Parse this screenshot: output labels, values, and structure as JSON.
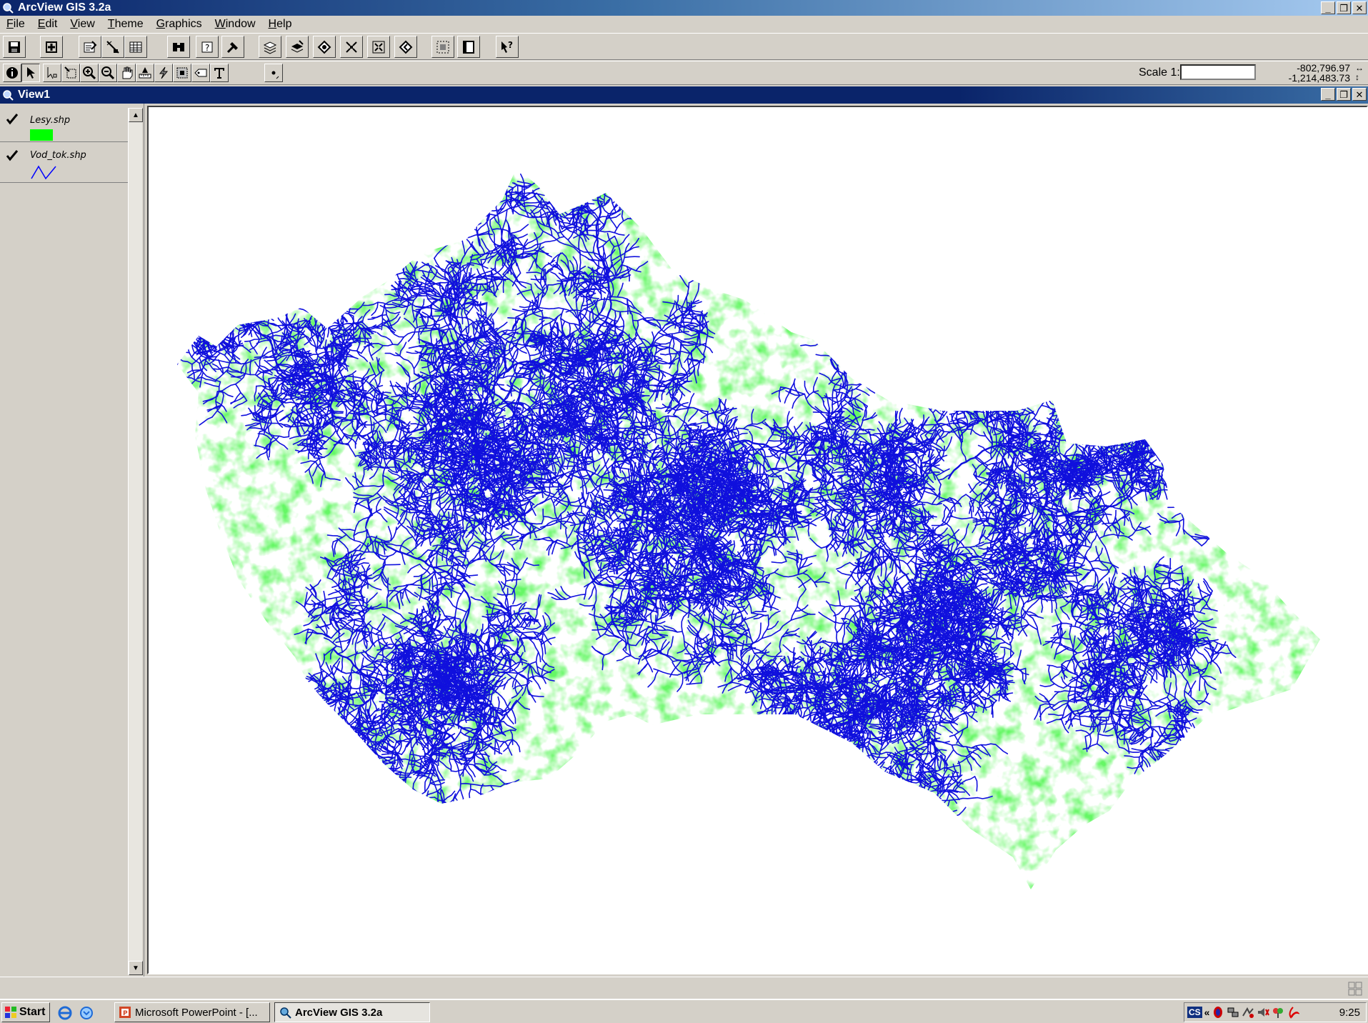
{
  "app": {
    "title": "ArcView GIS 3.2a"
  },
  "menu": [
    "File",
    "Edit",
    "View",
    "Theme",
    "Graphics",
    "Window",
    "Help"
  ],
  "toolbar": {
    "buttons": [
      "save-icon",
      "add-theme-icon",
      "theme-properties-icon",
      "edit-legend-icon",
      "open-table-icon",
      "find-icon",
      "locate-address-icon",
      "query-builder-icon",
      "zoom-to-full-extent-icon",
      "zoom-to-active-themes-icon",
      "zoom-to-selected-icon",
      "zoom-in-icon",
      "zoom-out-icon",
      "zoom-previous-icon",
      "select-by-theme-icon",
      "clear-selection-icon",
      "help-icon"
    ],
    "tools": [
      "identify-icon",
      "pointer-icon",
      "vertex-edit-icon",
      "select-feature-icon",
      "zoom-in-tool-icon",
      "zoom-out-tool-icon",
      "pan-icon",
      "measure-icon",
      "hotlink-icon",
      "area-of-interest-icon",
      "label-icon",
      "text-tool-icon",
      "draw-point-icon"
    ]
  },
  "scale": {
    "label": "Scale 1:",
    "value": ""
  },
  "coordinates": {
    "x": "-802,796.97",
    "y": "-1,214,483.73"
  },
  "view": {
    "title": "View1"
  },
  "themes": [
    {
      "name": "Lesy.shp",
      "checked": true,
      "symbol": "fill",
      "color": "#00ff00"
    },
    {
      "name": "Vod_tok.shp",
      "checked": true,
      "symbol": "line",
      "color": "#0000ff"
    }
  ],
  "map": {
    "fill_color": "#22ee22",
    "line_color": "#1010dd"
  },
  "taskbar": {
    "start": "Start",
    "tasks": [
      {
        "label": "Microsoft PowerPoint - [...",
        "active": false
      },
      {
        "label": "ArcView GIS 3.2a",
        "active": true
      }
    ],
    "tray_lang": "CS",
    "time": "9:25"
  }
}
